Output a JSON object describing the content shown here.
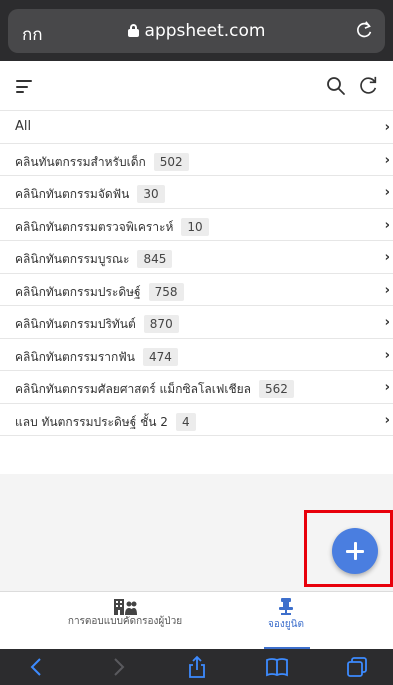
{
  "browser": {
    "aa_label": "กก",
    "url": "appsheet.com"
  },
  "list": {
    "items": [
      {
        "label": "All",
        "count": ""
      },
      {
        "label": "คลินทันตกรรมสำหรับเด็ก",
        "count": "502"
      },
      {
        "label": "คลินิกทันตกรรมจัดฟัน",
        "count": "30"
      },
      {
        "label": "คลินิกทันตกรรมตรวจพิเคราะห์",
        "count": "10"
      },
      {
        "label": "คลินิกทันตกรรมบูรณะ",
        "count": "845"
      },
      {
        "label": "คลินิกทันตกรรมประดิษฐ์",
        "count": "758"
      },
      {
        "label": "คลินิกทันตกรรมปริทันต์",
        "count": "870"
      },
      {
        "label": "คลินิกทันตกรรมรากฟัน",
        "count": "474"
      },
      {
        "label": "คลินิกทันตกรรมศัลยศาสตร์ แม็กซิลโลเฟเชียล",
        "count": "562"
      },
      {
        "label": "แลบ ทันตกรรมประดิษฐ์ ชั้น 2",
        "count": "4"
      }
    ],
    "chevron": "›"
  },
  "tabs": {
    "left_label": "การตอบแบบคัดกรองผู้ป่วย",
    "right_label": "จองยูนิต"
  },
  "colors": {
    "accent": "#3d6fcc",
    "fab": "#4a7ee0",
    "highlight": "#e8000b"
  },
  "icons": {
    "fab": "plus-icon",
    "left_tab": "building-users-icon",
    "right_tab": "dental-chair-icon"
  }
}
